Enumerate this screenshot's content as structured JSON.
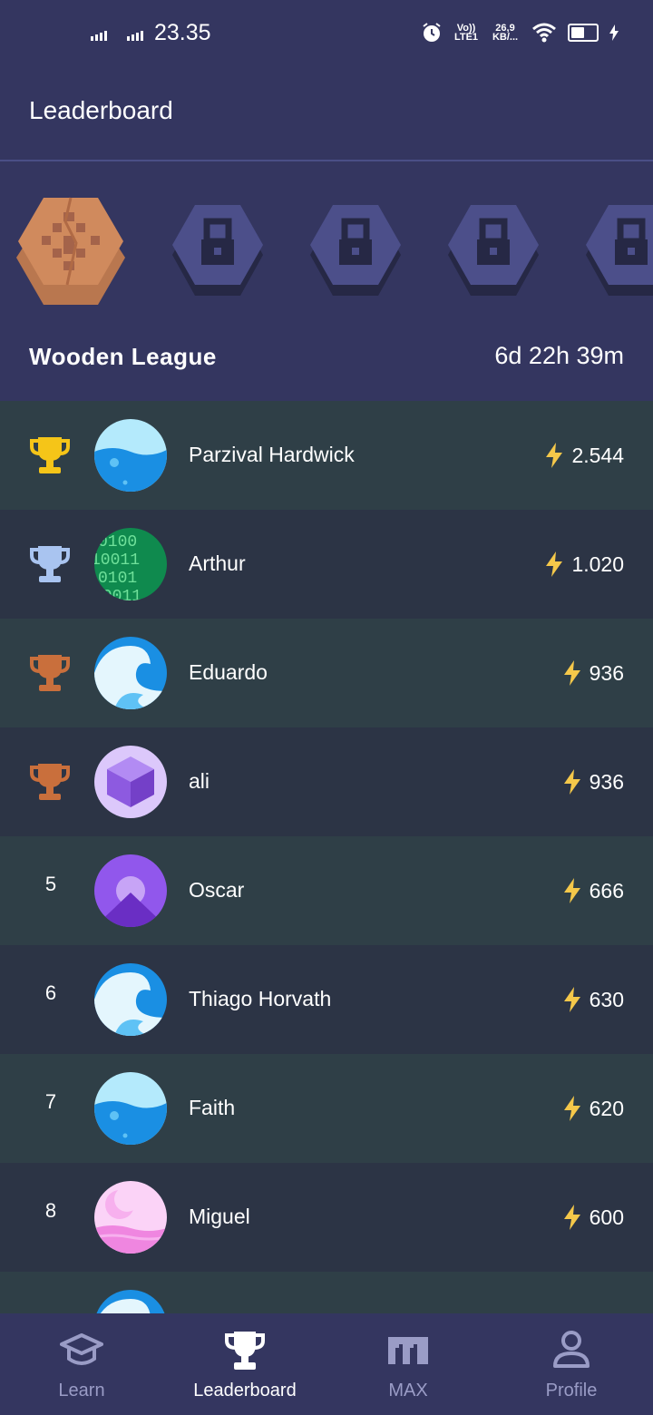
{
  "status_bar": {
    "time": "23.35",
    "network_top": "Vo)) LTE1",
    "speed": "26,9 KB/...",
    "icons": [
      "signal-icon",
      "signal-icon",
      "alarm-icon",
      "volte-icon",
      "wifi-icon",
      "battery-icon",
      "charging-icon"
    ]
  },
  "header": {
    "title": "Leaderboard"
  },
  "league": {
    "name": "Wooden League",
    "time_remaining": "6d 22h 39m",
    "badges": [
      {
        "state": "current",
        "icon": "wooden-league-badge"
      },
      {
        "state": "locked",
        "icon": "lock-icon"
      },
      {
        "state": "locked",
        "icon": "lock-icon"
      },
      {
        "state": "locked",
        "icon": "lock-icon"
      },
      {
        "state": "locked",
        "icon": "lock-icon"
      }
    ]
  },
  "leaderboard": {
    "rows": [
      {
        "rank": "1",
        "trophy": "gold",
        "name": "Parzival Hardwick",
        "score": "2.544",
        "avatar": "water-avatar"
      },
      {
        "rank": "2",
        "trophy": "silver",
        "name": "Arthur",
        "score": "1.020",
        "avatar": "binary-avatar"
      },
      {
        "rank": "3",
        "trophy": "bronze",
        "name": "Eduardo",
        "score": "936",
        "avatar": "wave-avatar"
      },
      {
        "rank": "4",
        "trophy": "bronze",
        "name": "ali",
        "score": "936",
        "avatar": "cube-avatar"
      },
      {
        "rank": "5",
        "trophy": "",
        "name": "Oscar",
        "score": "666",
        "avatar": "mountain-avatar"
      },
      {
        "rank": "6",
        "trophy": "",
        "name": "Thiago Horvath",
        "score": "630",
        "avatar": "wave-avatar"
      },
      {
        "rank": "7",
        "trophy": "",
        "name": "Faith",
        "score": "620",
        "avatar": "water-avatar"
      },
      {
        "rank": "8",
        "trophy": "",
        "name": "Miguel",
        "score": "600",
        "avatar": "moon-avatar"
      }
    ]
  },
  "nav": {
    "items": [
      {
        "label": "Learn",
        "icon": "graduation-cap-icon",
        "active": false
      },
      {
        "label": "Leaderboard",
        "icon": "trophy-icon",
        "active": true
      },
      {
        "label": "MAX",
        "icon": "max-logo-icon",
        "active": false
      },
      {
        "label": "Profile",
        "icon": "person-icon",
        "active": false
      }
    ]
  },
  "colors": {
    "header_bg": "#343660",
    "row_even": "#2f3f47",
    "row_odd": "#2c3445",
    "gold": "#f5c518",
    "silver": "#a9c4f0",
    "bronze": "#c96f3c",
    "bolt": "#f5c84a",
    "nav_inactive": "#9a9cc6"
  }
}
